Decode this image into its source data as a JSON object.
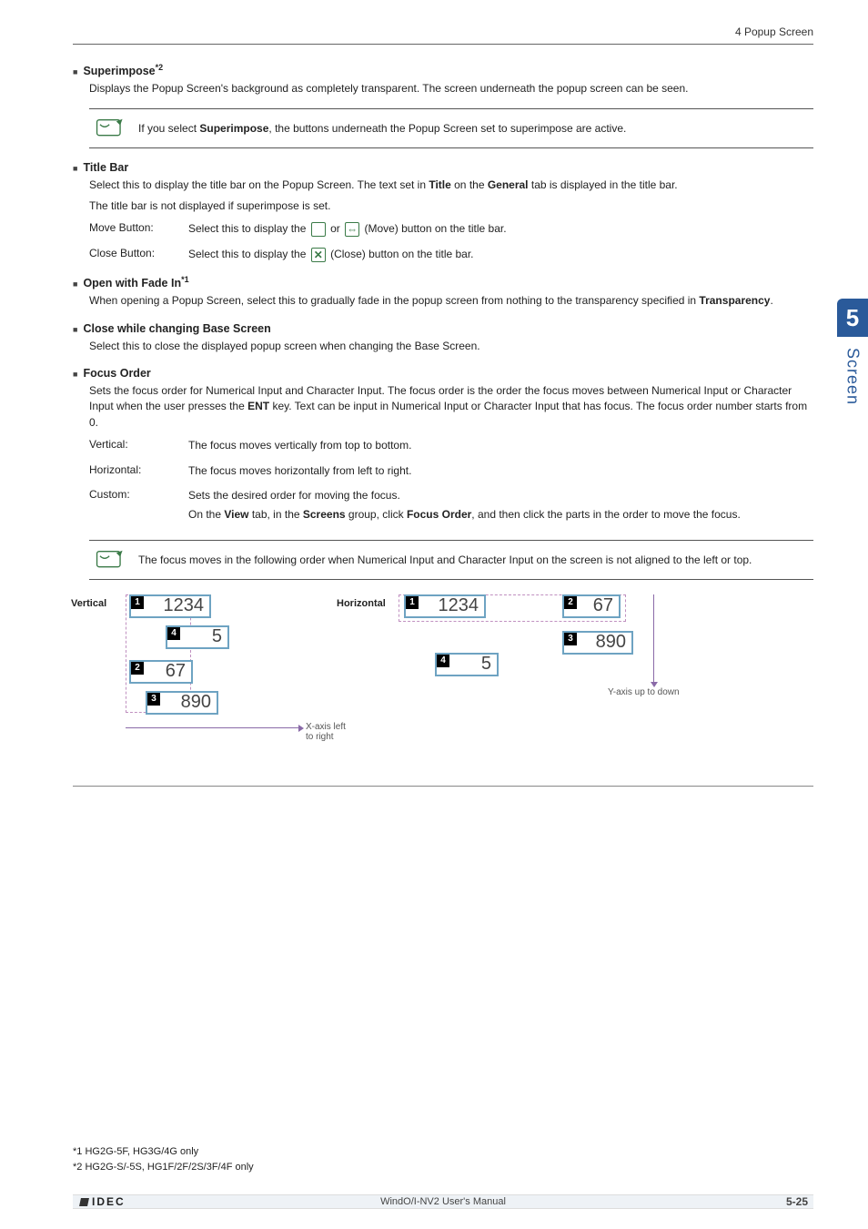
{
  "header": {
    "section": "4 Popup Screen"
  },
  "sideTab": {
    "num": "5",
    "label": "Screen"
  },
  "superimpose": {
    "title": "Superimpose",
    "fnref": "*2",
    "body": "Displays the Popup Screen's background as completely transparent. The screen underneath the popup screen can be seen.",
    "note_a": "If you select ",
    "note_bold": "Superimpose",
    "note_b": ", the buttons underneath the Popup Screen set to superimpose are active."
  },
  "titleBar": {
    "title": "Title Bar",
    "body_a": "Select this to display the title bar on the Popup Screen. The text set in ",
    "bold1": "Title",
    "mid1": " on the ",
    "bold2": "General",
    "body_b": " tab is displayed in the title bar.",
    "body2": "The title bar is not displayed if superimpose is set.",
    "moveLabel": "Move Button:",
    "moveText_a": "Select this to display the ",
    "moveText_b": " or ",
    "moveText_c": " (Move) button on the title bar.",
    "closeLabel": "Close Button:",
    "closeText_a": "Select this to display the ",
    "closeText_b": " (Close) button on the title bar."
  },
  "fadeIn": {
    "title": "Open with Fade In",
    "fnref": "*1",
    "body_a": "When opening a Popup Screen, select this to gradually fade in the popup screen from nothing to the transparency specified in ",
    "bold": "Transparency",
    "body_b": "."
  },
  "closeChange": {
    "title": "Close while changing Base Screen",
    "body": "Select this to close the displayed popup screen when changing the Base Screen."
  },
  "focusOrder": {
    "title": "Focus Order",
    "body_a": "Sets the focus order for Numerical Input and Character Input. The focus order is the order the focus moves between Numerical Input or Character Input when the user presses the ",
    "bold": "ENT",
    "body_b": " key. Text can be input in Numerical Input or Character Input that has focus. The focus order number starts from 0.",
    "rows": {
      "vertK": "Vertical:",
      "vertV": "The focus moves vertically from top to bottom.",
      "horzK": "Horizontal:",
      "horzV": "The focus moves horizontally from left to right.",
      "custK": "Custom:",
      "custV": "Sets the desired order for moving the focus.",
      "custV2_a": "On the ",
      "custV2_b1": "View",
      "custV2_c": " tab, in the ",
      "custV2_b2": "Screens",
      "custV2_d": " group, click ",
      "custV2_b3": "Focus Order",
      "custV2_e": ", and then click the parts in the order to move the focus."
    },
    "note": "The focus moves in the following order when Numerical Input and Character Input on the screen is not aligned to the left or top."
  },
  "diagram": {
    "leftTitle": "Vertical",
    "rightTitle": "Horizontal",
    "c1": "1234",
    "c2": "5",
    "c3": "67",
    "c4": "890",
    "n1": "1",
    "n2": "2",
    "n3": "3",
    "n4": "4",
    "xaxis": "X-axis left to right",
    "yaxis": "Y-axis up to down"
  },
  "footnotes": {
    "f1": "*1  HG2G-5F, HG3G/4G only",
    "f2": "*2  HG2G-S/-5S, HG1F/2F/2S/3F/4F only"
  },
  "footer": {
    "brand": "IDEC",
    "center": "WindO/I-NV2 User's Manual",
    "page": "5-25"
  }
}
